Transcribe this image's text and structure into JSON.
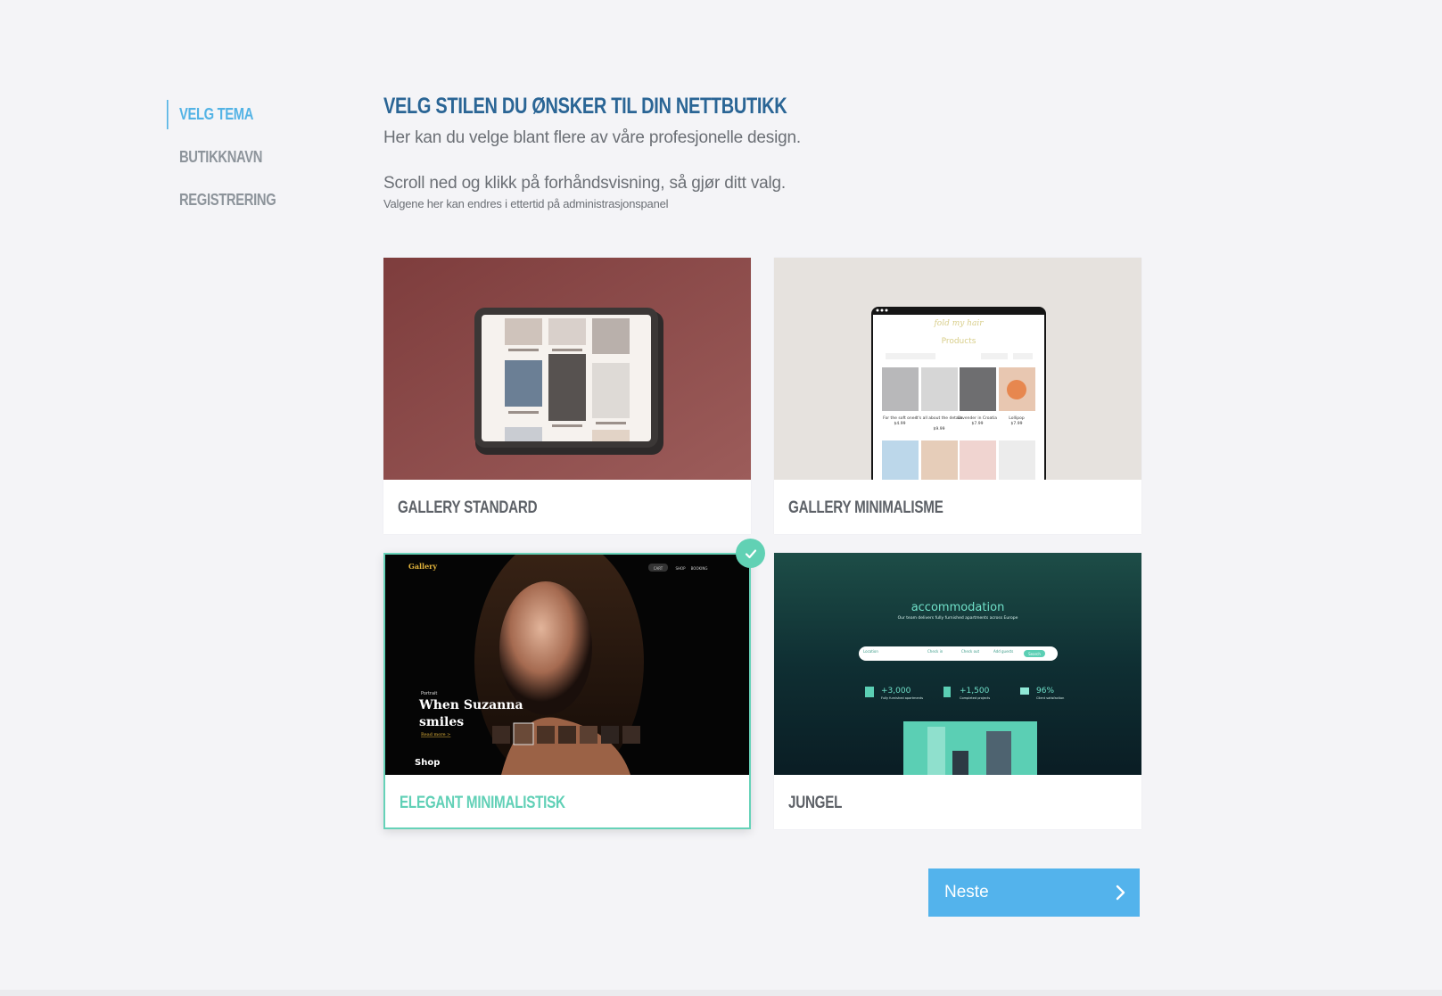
{
  "steps": [
    {
      "label": "VELG TEMA",
      "active": true
    },
    {
      "label": "BUTIKKNAVN",
      "active": false
    },
    {
      "label": "REGISTRERING",
      "active": false
    }
  ],
  "header": {
    "title": "VELG STILEN DU ØNSKER TIL DIN NETTBUTIKK",
    "subtitle": "Her kan du velge blant flere av våre profesjonelle design.",
    "instruction": "Scroll ned og klikk på forhåndsvisning, så gjør ditt valg.",
    "note": "Valgene her kan endres i ettertid på administrasjonspanel"
  },
  "themes": [
    {
      "label": "GALLERY STANDARD",
      "selected": false
    },
    {
      "label": "GALLERY MINIMALISME",
      "selected": false
    },
    {
      "label": "ELEGANT MINIMALISTISK",
      "selected": true
    },
    {
      "label": "JUNGEL",
      "selected": false
    }
  ],
  "previews": {
    "minimalisme": {
      "logo": "fold my hair",
      "heading": "Products",
      "products": [
        {
          "name": "For the soft ones",
          "price": "$4.99"
        },
        {
          "name": "It's all about the details",
          "price": "$9.99"
        },
        {
          "name": "Lavender in Croatia",
          "price": "$7.99"
        },
        {
          "name": "Lollipop",
          "price": "$7.99"
        }
      ]
    },
    "elegant": {
      "logo": "Gallery",
      "nav": [
        "CART",
        "SHOP",
        "BOOKING"
      ],
      "kicker": "Portrait",
      "headline_1": "When Suzanna",
      "headline_2": "smiles",
      "read_more": "Read more >",
      "shop": "Shop"
    },
    "jungel": {
      "title": "accommodation",
      "tagline": "Our team delivers fully furnished apartments across Europe",
      "search_fields": [
        "Location",
        "Check in",
        "Check out",
        "Add guests"
      ],
      "search_button": "Search",
      "stats": [
        {
          "value": "+3,000",
          "label": "Fully furnished apartments"
        },
        {
          "value": "+1,500",
          "label": "Completed projects"
        },
        {
          "value": "96%",
          "label": "Client satisfaction"
        }
      ]
    }
  },
  "next_button": {
    "label": "Neste"
  },
  "colors": {
    "accent": "#53b3e5",
    "title": "#2a6595",
    "selected": "#61d1b4",
    "background": "#f4f4f7"
  },
  "icons": {
    "check": "check-icon",
    "next": "chevron-right-icon"
  }
}
